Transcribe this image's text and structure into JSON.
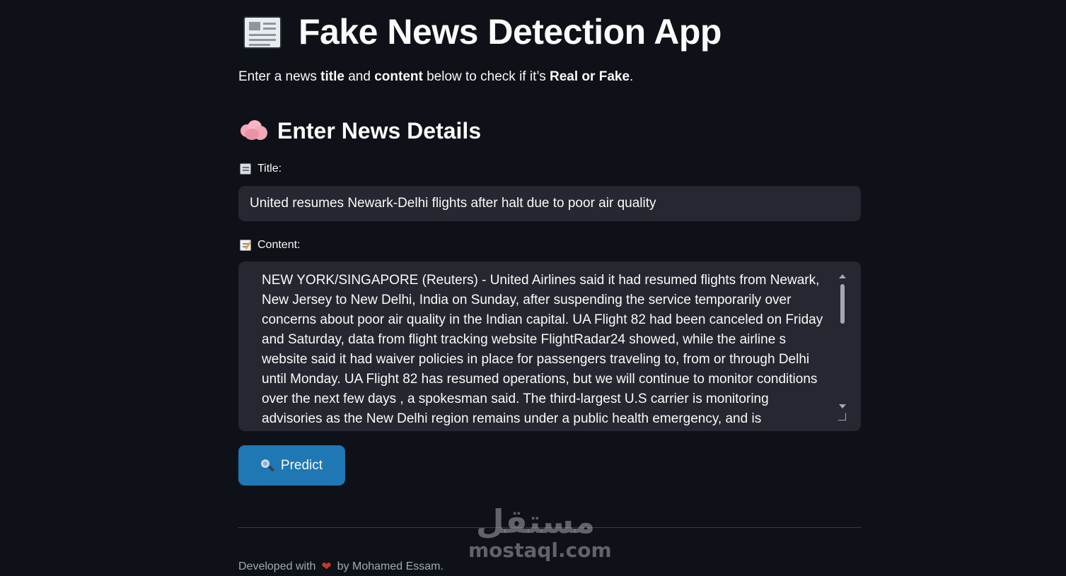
{
  "header": {
    "icon": "newspaper-icon",
    "title": "Fake News Detection App"
  },
  "intro": {
    "part1": "Enter a news ",
    "bold1": "title",
    "part2": " and ",
    "bold2": "content",
    "part3": " below to check if it’s ",
    "bold3": "Real or Fake",
    "part4": "."
  },
  "section": {
    "icon": "brain-icon",
    "title": "Enter News Details"
  },
  "form": {
    "title_label": "Title:",
    "title_value": "United resumes Newark-Delhi flights after halt due to poor air quality",
    "content_label": "Content:",
    "content_value": "NEW YORK/SINGAPORE (Reuters) - United Airlines said it had resumed flights from Newark, New Jersey to New Delhi, India on Sunday, after suspending the service temporarily over concerns about poor air quality in the Indian capital. UA Flight 82 had been canceled on Friday and Saturday, data from flight tracking website FlightRadar24 showed, while the airline s website said it had waiver policies in place for passengers traveling to, from or through Delhi until Monday. UA Flight 82 has resumed operations, but  we will continue to monitor conditions over the next few days , a spokesman said. The third-largest U.S carrier is monitoring advisories as the New Delhi region remains under a public health emergency, and is coordinating with",
    "predict_label": "Predict"
  },
  "footer": {
    "prefix": "Developed with",
    "suffix": "by Mohamed Essam."
  },
  "watermark": {
    "arabic": "مستقل",
    "latin": "mostaql.com"
  },
  "colors": {
    "background": "#0e1117",
    "input_bg": "#262730",
    "button": "#1f77b4",
    "text": "#fafafa",
    "muted": "#a3a8b4"
  }
}
